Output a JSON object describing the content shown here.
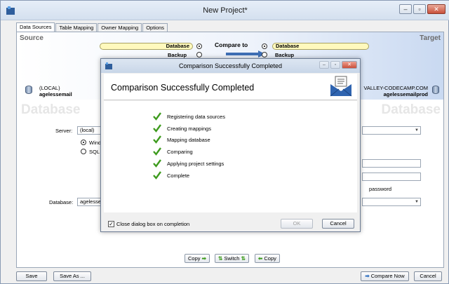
{
  "window": {
    "title": "New Project*"
  },
  "tabs": [
    {
      "label": "Data Sources"
    },
    {
      "label": "Table Mapping"
    },
    {
      "label": "Owner Mapping"
    },
    {
      "label": "Options"
    }
  ],
  "banner": {
    "source_heading": "Source",
    "target_heading": "Target",
    "compare_to": "Compare to",
    "left_database": "Database",
    "left_backup": "Backup",
    "right_database": "Database",
    "right_backup": "Backup",
    "source_server": "(LOCAL)",
    "source_db": "agelessemail",
    "target_server": "VALLEY-CODECAMP.COM",
    "target_db": "agelessemailprod"
  },
  "source_panel": {
    "watermark": "Database",
    "server_label": "Server:",
    "server_value": "(local)",
    "auth_windows": "Windo",
    "auth_sql": "SQL S",
    "database_label": "Database:",
    "database_value": "agelessem"
  },
  "target_panel": {
    "watermark": "Database",
    "remember_password": "password"
  },
  "copy_buttons": {
    "copy_right": "Copy",
    "switch": "Switch",
    "copy_left": "Copy"
  },
  "bottom": {
    "save": "Save",
    "save_as": "Save As ...",
    "compare_now": "Compare Now",
    "cancel": "Cancel"
  },
  "dialog": {
    "title": "Comparison Successfully Completed",
    "heading": "Comparison Successfully Completed",
    "steps": [
      "Registering data sources",
      "Creating mappings",
      "Mapping database",
      "Comparing",
      "Applying project settings",
      "Complete"
    ],
    "close_on_completion": "Close dialog box on completion",
    "ok": "OK",
    "cancel": "Cancel",
    "check_color": "#3e9b1e"
  }
}
